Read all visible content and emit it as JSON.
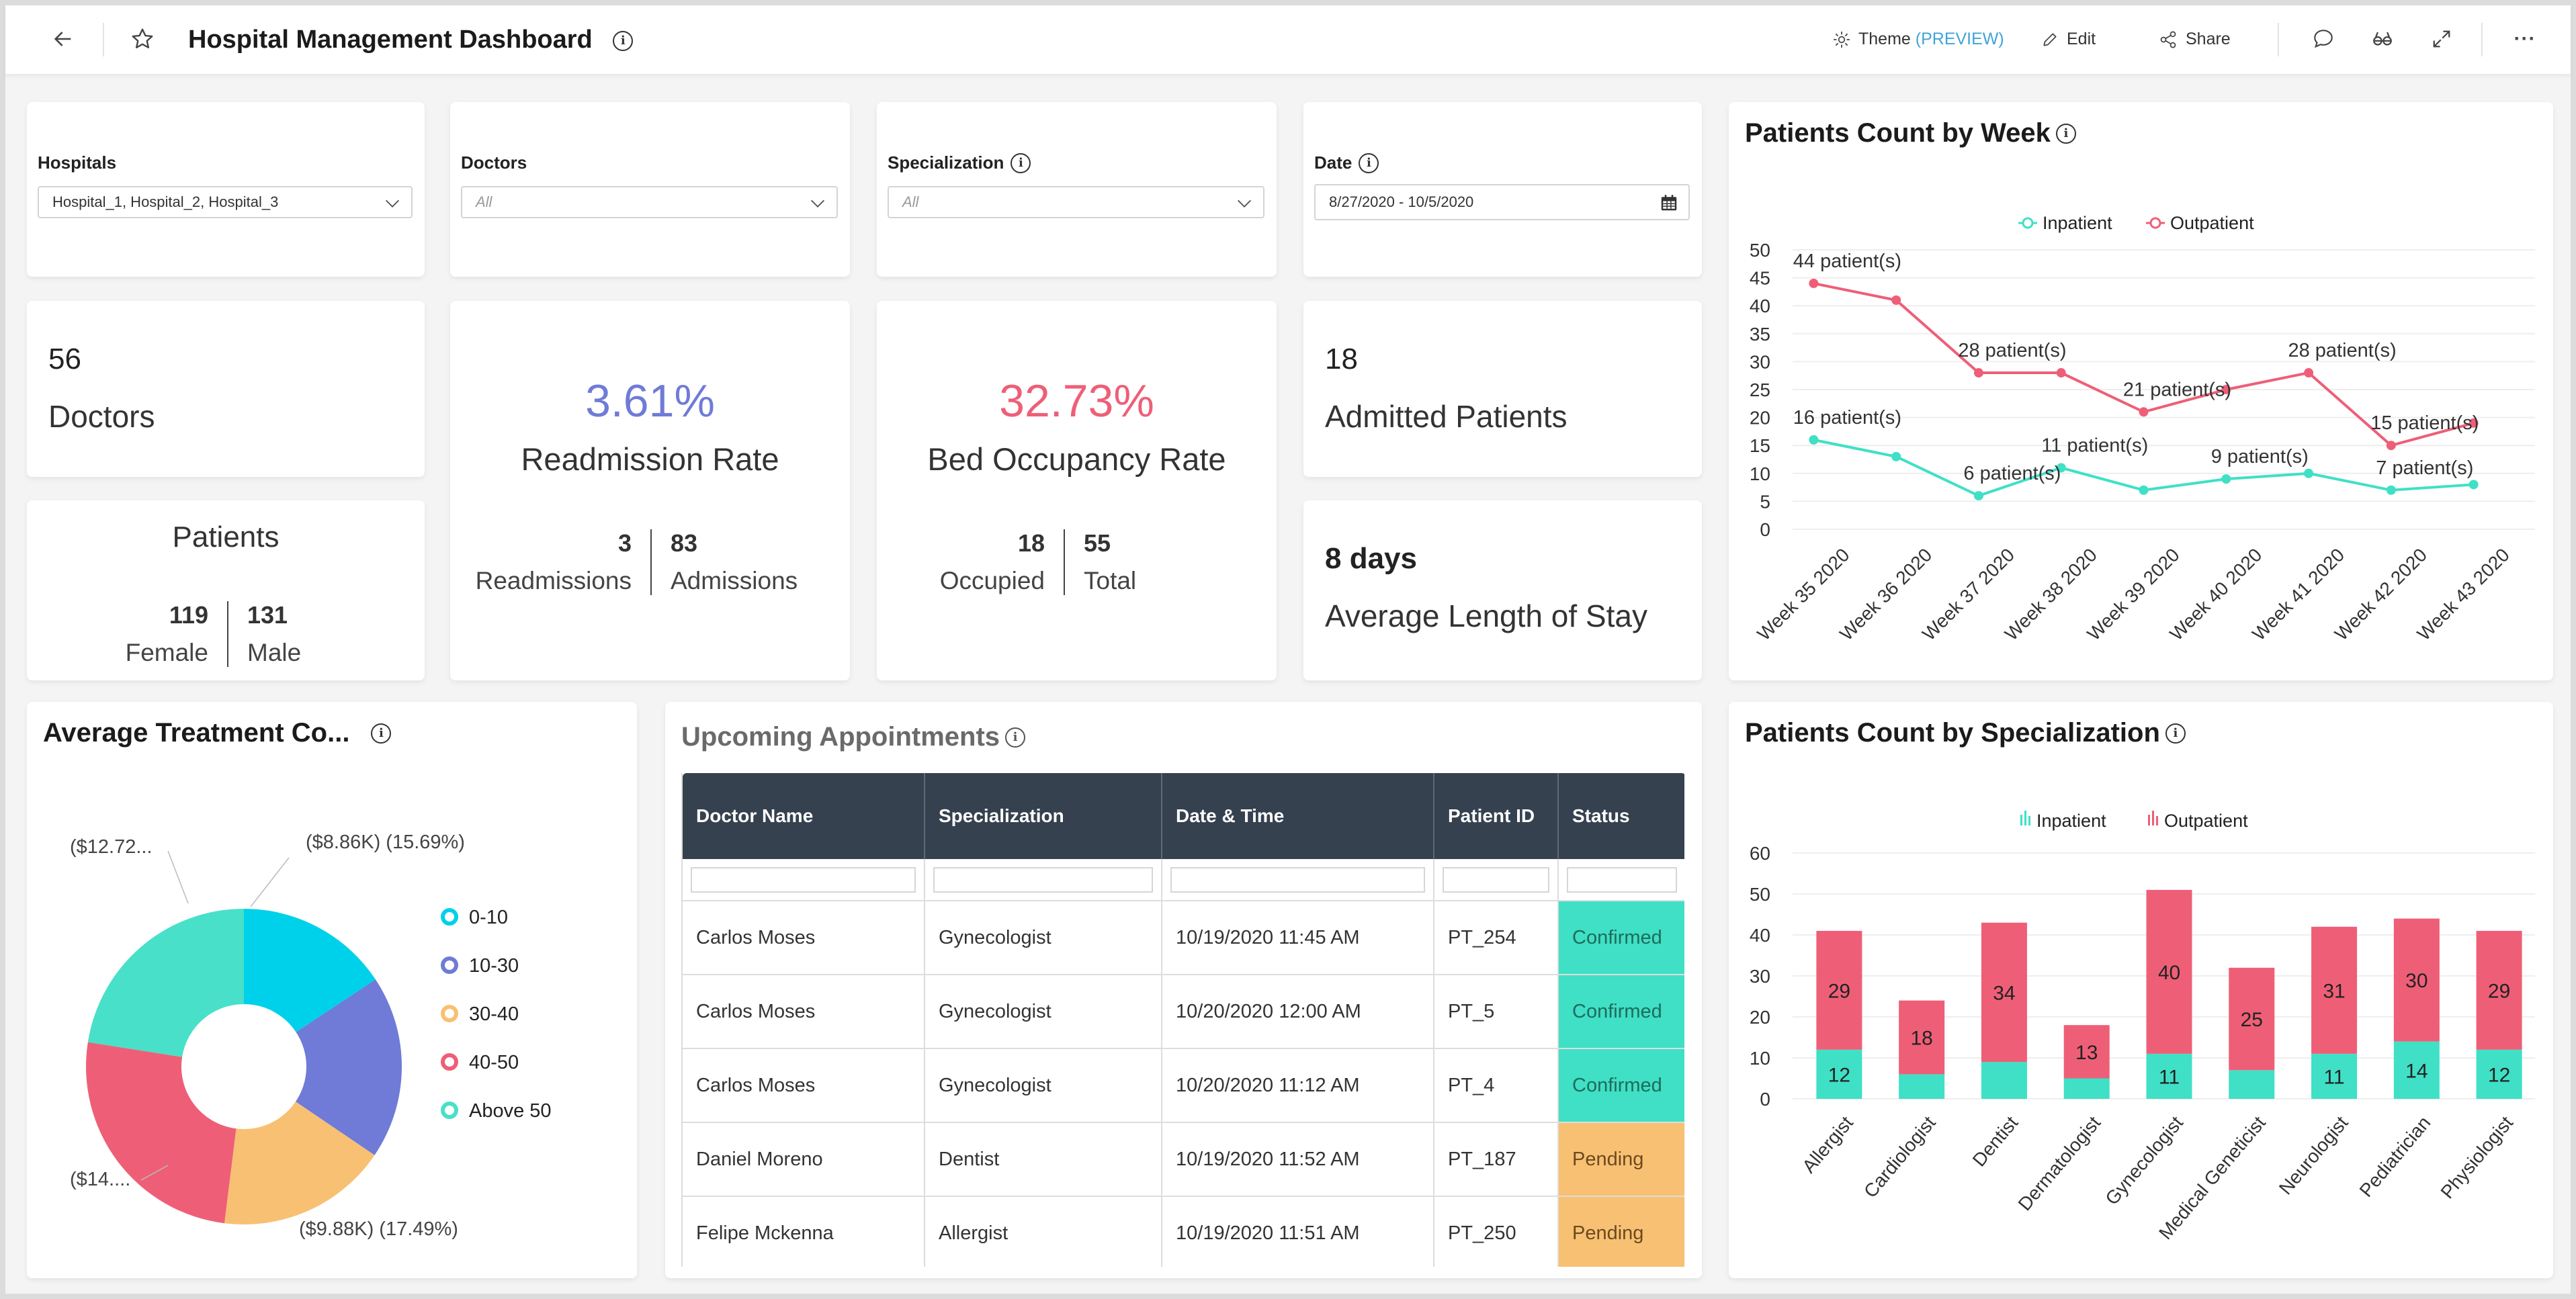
{
  "header": {
    "title": "Hospital Management Dashboard",
    "actions": {
      "theme_label": "Theme",
      "theme_badge": "(PREVIEW)",
      "edit_label": "Edit",
      "share_label": "Share"
    }
  },
  "filters": {
    "hospitals": {
      "label": "Hospitals",
      "value": "Hospital_1, Hospital_2, Hospital_3"
    },
    "doctors": {
      "label": "Doctors",
      "placeholder": "All"
    },
    "specialization": {
      "label": "Specialization",
      "placeholder": "All"
    },
    "date": {
      "label": "Date",
      "value": "8/27/2020 - 10/5/2020"
    }
  },
  "kpis": {
    "doctors": {
      "value": "56",
      "label": "Doctors"
    },
    "patients": {
      "title": "Patients",
      "female_value": "119",
      "female_label": "Female",
      "male_value": "131",
      "male_label": "Male"
    },
    "readmission": {
      "value": "3.61%",
      "label": "Readmission Rate",
      "readmissions_value": "3",
      "readmissions_label": "Readmissions",
      "admissions_value": "83",
      "admissions_label": "Admissions",
      "color": "#6f7bd6"
    },
    "bed_occupancy": {
      "value": "32.73%",
      "label": "Bed Occupancy Rate",
      "occupied_value": "18",
      "occupied_label": "Occupied",
      "total_value": "55",
      "total_label": "Total",
      "color": "#ee5f77"
    },
    "admitted": {
      "value": "18",
      "label": "Admitted Patients"
    },
    "avg_stay": {
      "value": "8 days",
      "label": "Average Length of Stay"
    }
  },
  "appointments": {
    "title": "Upcoming Appointments",
    "columns": [
      "Doctor Name",
      "Specialization",
      "Date & Time",
      "Patient ID",
      "Status"
    ],
    "rows": [
      [
        "Carlos Moses",
        "Gynecologist",
        "10/19/2020 11:45 AM",
        "PT_254",
        "Confirmed"
      ],
      [
        "Carlos Moses",
        "Gynecologist",
        "10/20/2020 12:00 AM",
        "PT_5",
        "Confirmed"
      ],
      [
        "Carlos Moses",
        "Gynecologist",
        "10/20/2020 11:12 AM",
        "PT_4",
        "Confirmed"
      ],
      [
        "Daniel Moreno",
        "Dentist",
        "10/19/2020 11:52 AM",
        "PT_187",
        "Pending"
      ],
      [
        "Felipe Mckenna",
        "Allergist",
        "10/19/2020 11:51 AM",
        "PT_250",
        "Pending"
      ]
    ],
    "status_colors": {
      "Confirmed": "#3fe0c5",
      "Pending": "#f8c073"
    }
  },
  "chart_data": [
    {
      "id": "patients_by_week",
      "type": "line",
      "title": "Patients Count by Week",
      "categories": [
        "Week 35 2020",
        "Week 36 2020",
        "Week 37 2020",
        "Week 38 2020",
        "Week 39 2020",
        "Week 40 2020",
        "Week 41 2020",
        "Week 42 2020",
        "Week 43 2020"
      ],
      "series": [
        {
          "name": "Inpatient",
          "color": "#3fe0c5",
          "values": [
            16,
            13,
            6,
            11,
            7,
            9,
            10,
            7,
            8
          ]
        },
        {
          "name": "Outpatient",
          "color": "#ee5f77",
          "values": [
            44,
            41,
            28,
            28,
            21,
            25,
            28,
            15,
            19
          ]
        }
      ],
      "data_labels": [
        {
          "series": "Outpatient",
          "index": 0,
          "text": "44 patient(s)"
        },
        {
          "series": "Outpatient",
          "index": 2,
          "text": "28 patient(s)"
        },
        {
          "series": "Outpatient",
          "index": 4,
          "text": "21 patient(s)"
        },
        {
          "series": "Outpatient",
          "index": 6,
          "text": "28 patient(s)"
        },
        {
          "series": "Outpatient",
          "index": 7,
          "text": "15 patient(s)"
        },
        {
          "series": "Inpatient",
          "index": 0,
          "text": "16 patient(s)"
        },
        {
          "series": "Inpatient",
          "index": 2,
          "text": "6 patient(s)"
        },
        {
          "series": "Inpatient",
          "index": 3,
          "text": "11 patient(s)"
        },
        {
          "series": "Inpatient",
          "index": 5,
          "text": "9 patient(s)"
        },
        {
          "series": "Inpatient",
          "index": 7,
          "text": "7 patient(s)"
        }
      ],
      "yticks": [
        0,
        5,
        10,
        15,
        20,
        25,
        30,
        35,
        40,
        45,
        50
      ],
      "ylim": [
        0,
        50
      ],
      "legend": "top-center",
      "grid": true
    },
    {
      "id": "avg_treatment_cost",
      "type": "pie",
      "donut": true,
      "title": "Average Treatment Co...",
      "categories": [
        "0-10",
        "10-30",
        "30-40",
        "40-50",
        "Above 50"
      ],
      "values": [
        15.69,
        18.79,
        17.49,
        25.5,
        22.53
      ],
      "colors": [
        "#00d1ea",
        "#6f7bd6",
        "#f8c073",
        "#ee5f77",
        "#48e0c8"
      ],
      "slice_labels": [
        "($8.86K) (15.69%)",
        "",
        "($9.88K) (17.49%)",
        "($14....",
        "($12.72..."
      ],
      "legend": "right"
    },
    {
      "id": "patients_by_specialization",
      "type": "bar",
      "stacked": true,
      "title": "Patients Count by Specialization",
      "categories": [
        "Allergist",
        "Cardiologist",
        "Dentist",
        "Dermatologist",
        "Gynecologist",
        "Medical Geneticist",
        "Neurologist",
        "Pediatrician",
        "Physiologist"
      ],
      "series": [
        {
          "name": "Inpatient",
          "color": "#3fe0c5",
          "values": [
            12,
            6,
            9,
            5,
            11,
            7,
            11,
            14,
            12
          ],
          "labels": [
            "12",
            "",
            "",
            "",
            "11",
            "",
            "11",
            "14",
            "12"
          ]
        },
        {
          "name": "Outpatient",
          "color": "#ee5f77",
          "values": [
            29,
            18,
            34,
            13,
            40,
            25,
            31,
            30,
            29
          ],
          "labels": [
            "29",
            "18",
            "34",
            "13",
            "40",
            "25",
            "31",
            "30",
            "29"
          ]
        }
      ],
      "yticks": [
        0,
        10,
        20,
        30,
        40,
        50,
        60
      ],
      "ylim": [
        0,
        60
      ],
      "legend": "top-center",
      "grid": true
    }
  ]
}
